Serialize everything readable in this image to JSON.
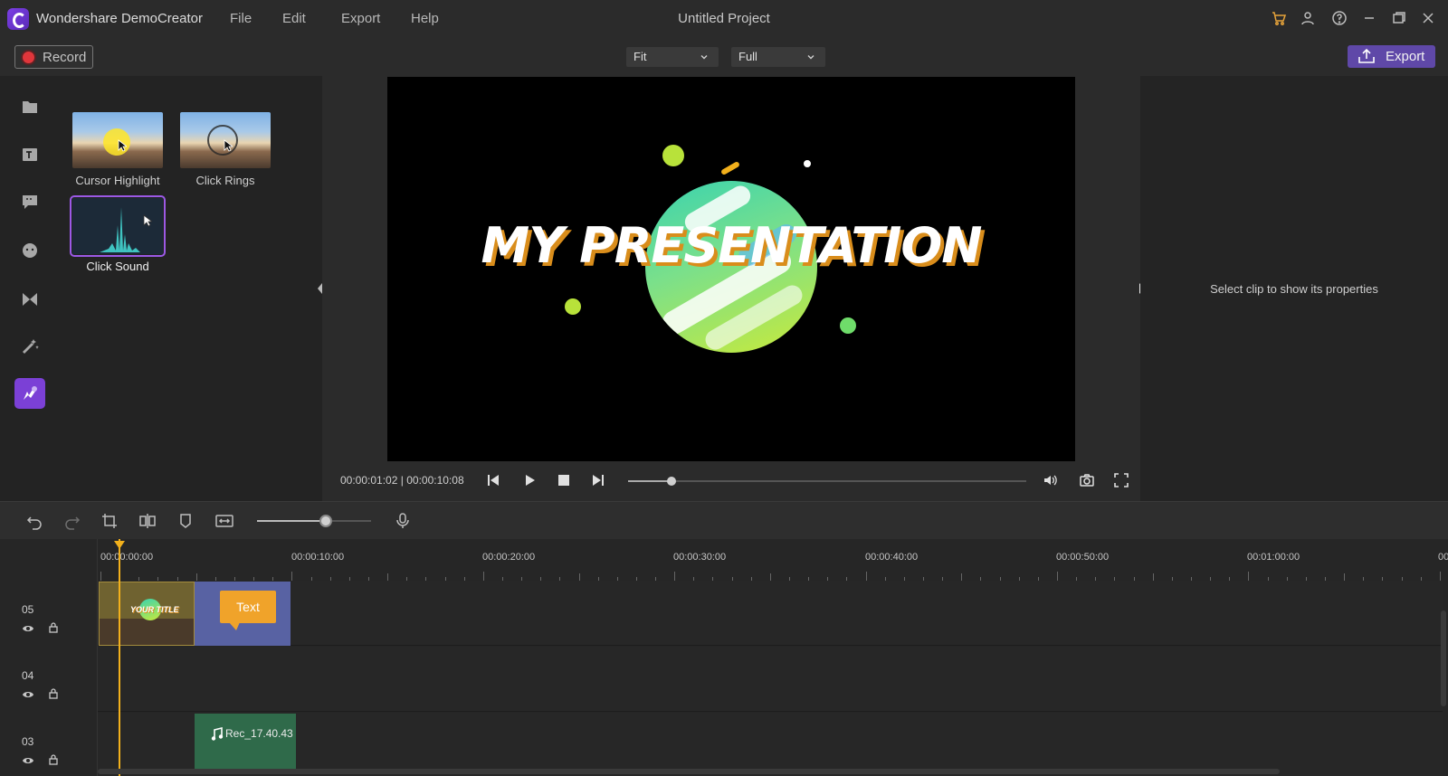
{
  "app": {
    "name": "Wondershare DemoCreator",
    "project_title": "Untitled Project"
  },
  "menu": {
    "items": [
      "File",
      "Edit",
      "Export",
      "Help"
    ]
  },
  "window_icons": [
    "cart-icon",
    "user-icon",
    "help-icon",
    "minimize-icon",
    "restore-icon",
    "close-icon"
  ],
  "toolbar": {
    "record_label": "Record",
    "fit_value": "Fit",
    "quality_value": "Full",
    "export_label": "Export"
  },
  "leftnav": {
    "items": [
      "media-icon",
      "text-icon",
      "caption-icon",
      "sticker-icon",
      "transition-icon",
      "effects-icon",
      "cursor-effects-icon"
    ],
    "active": "cursor-effects-icon"
  },
  "effects": {
    "items": [
      {
        "name": "Cursor Highlight",
        "selected": false
      },
      {
        "name": "Click Rings",
        "selected": false
      },
      {
        "name": "Click Sound",
        "selected": true
      }
    ]
  },
  "preview": {
    "title_text": "MY PRESENTATION",
    "current_time": "00:00:01:02",
    "separator": "|",
    "total_time": "00:00:10:08",
    "progress": 0.11
  },
  "properties": {
    "hint": "Select clip to show its properties"
  },
  "timeline_toolbar": {
    "icons": [
      "undo-icon",
      "redo-icon",
      "crop-icon",
      "split-icon",
      "marker-icon",
      "fit-timeline-icon",
      "microphone-icon"
    ],
    "zoom_level": 0.6
  },
  "timeline": {
    "ruler_labels": [
      "00:00:00:00",
      "00:00:10:00",
      "00:00:20:00",
      "00:00:30:00",
      "00:00:40:00",
      "00:00:50:00",
      "00:01:00:00",
      "00"
    ],
    "tracks": [
      {
        "number": "05",
        "clips": [
          "title-clip",
          "text-clip"
        ]
      },
      {
        "number": "04",
        "clips": []
      },
      {
        "number": "03",
        "clips": [
          "audio-clip"
        ]
      }
    ],
    "text_clip_label": "Text",
    "title_clip_label": "YOUR TITLE",
    "audio_clip_label": "Rec_17.40.43"
  },
  "colors": {
    "accent": "#7b40d6",
    "export_button": "#5f48a8",
    "record_red": "#e0363b",
    "playhead": "#f2b01c",
    "text_clip": "#5862a3",
    "audio_clip": "#2f6a4a"
  }
}
